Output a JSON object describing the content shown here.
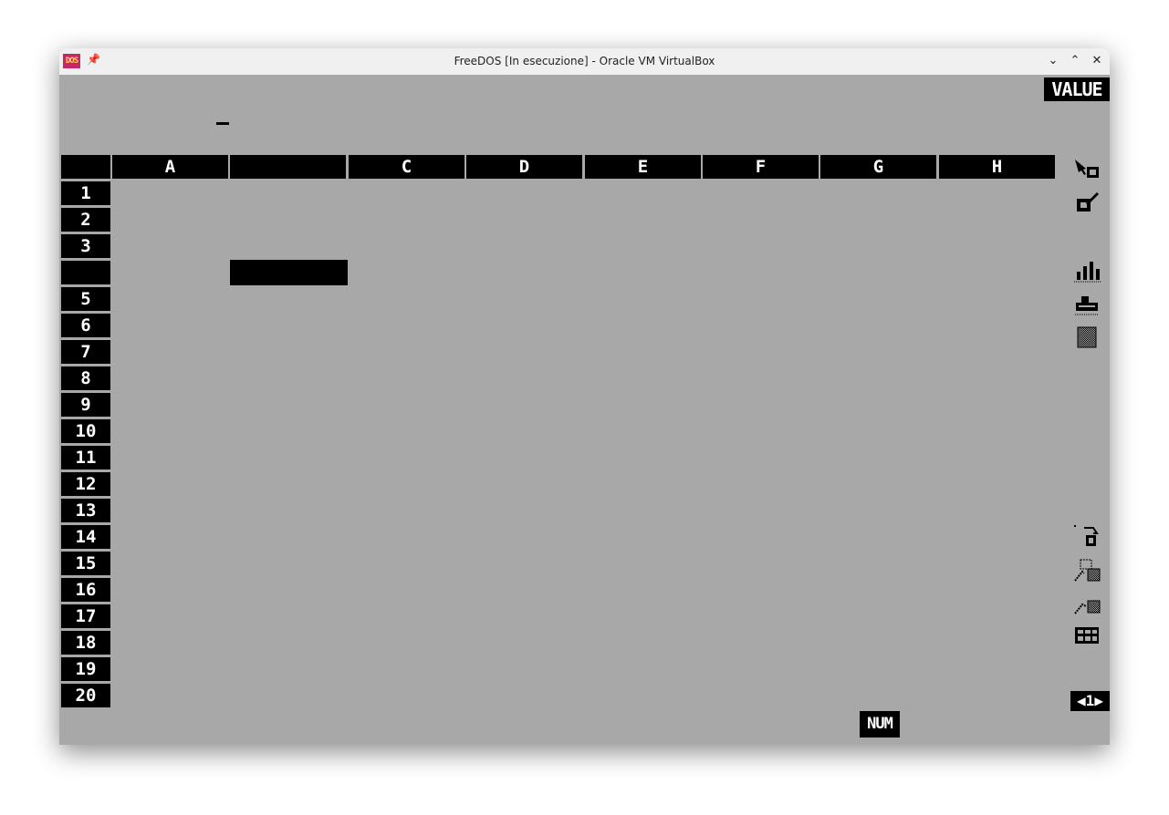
{
  "window": {
    "title": "FreeDOS [In esecuzione] - Oracle VM VirtualBox",
    "app_icon_text": "DOS",
    "pin_glyph": "📌",
    "buttons": {
      "minimize": "⌄",
      "maximize": "⌃",
      "close": "✕"
    }
  },
  "spreadsheet": {
    "mode_indicator": "VALUE",
    "columns": [
      "A",
      "",
      "C",
      "D",
      "E",
      "F",
      "G",
      "H"
    ],
    "rows": [
      "1",
      "2",
      "3",
      "",
      "5",
      "6",
      "7",
      "8",
      "9",
      "10",
      "11",
      "12",
      "13",
      "14",
      "15",
      "16",
      "17",
      "18",
      "19",
      "20"
    ],
    "status": {
      "num_lock": "NUM",
      "sheet_indicator": "◀1▶"
    }
  },
  "toolbar_icons": [
    "cell-pointer-icon",
    "edit-cell-icon",
    "bar-chart-icon",
    "printer-icon",
    "grid-pattern-icon",
    "delete-cell-icon",
    "copy-range-icon",
    "move-range-icon",
    "table-icon"
  ]
}
